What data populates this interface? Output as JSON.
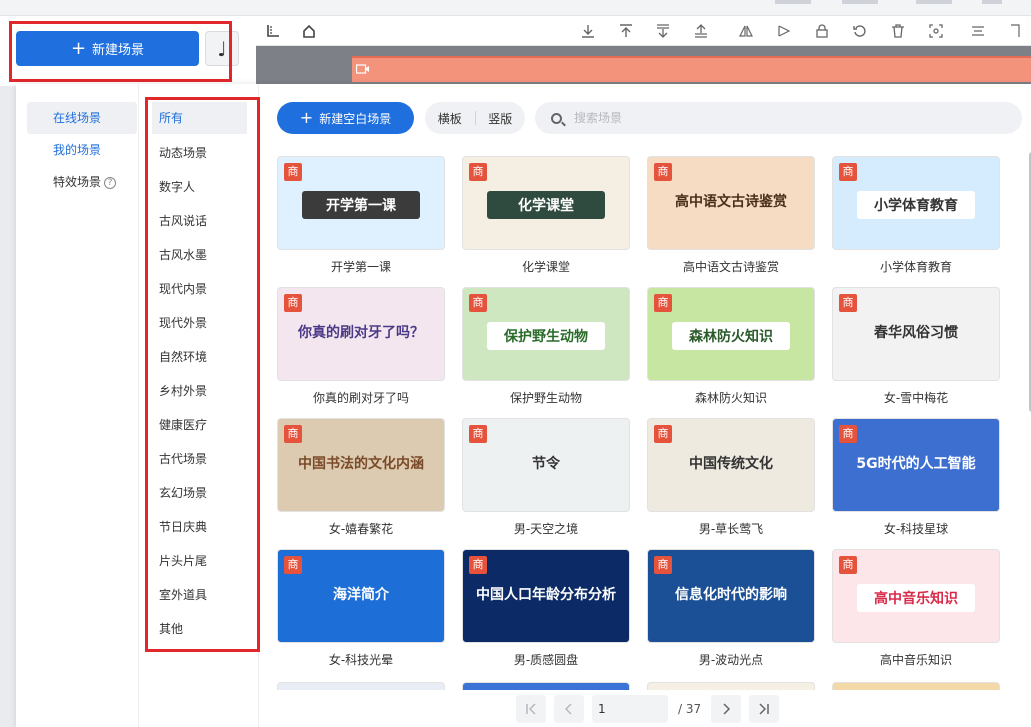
{
  "left_top": {
    "new_scene_label": "新建场景",
    "music_icon": "♩"
  },
  "timeline": {
    "track_label": ""
  },
  "tabs": [
    {
      "label": "在线场景",
      "active": true
    },
    {
      "label": "我的场景",
      "active": false
    },
    {
      "label": "特效场景",
      "active": false,
      "help": "?"
    }
  ],
  "categories": [
    "所有",
    "动态场景",
    "数字人",
    "古风说话",
    "古风水墨",
    "现代内景",
    "现代外景",
    "自然环境",
    "乡村外景",
    "健康医疗",
    "古代场景",
    "玄幻场景",
    "节日庆典",
    "片头片尾",
    "室外道具",
    "其他"
  ],
  "actions": {
    "blank_scene_label": "新建空白场景",
    "landscape_label": "横板",
    "portrait_label": "竖版"
  },
  "search": {
    "placeholder": "搜索场景"
  },
  "badge_label": "商",
  "cards": [
    {
      "name": "开学第一课",
      "thumb_title": "开学第一课",
      "bg": "#dff0ff",
      "fg": "#ffffff",
      "title_bg": "#3b3b3b"
    },
    {
      "name": "化学课堂",
      "thumb_title": "化学课堂",
      "bg": "#f4efe2",
      "fg": "#ffffff",
      "title_bg": "#2f4a3f"
    },
    {
      "name": "高中语文古诗鉴赏",
      "thumb_title": "高中语文古诗鉴赏",
      "bg": "#f7dcc4",
      "fg": "#4a2e1a",
      "title_bg": "transparent"
    },
    {
      "name": "小学体育教育",
      "thumb_title": "小学体育教育",
      "bg": "#d5ecff",
      "fg": "#333333",
      "title_bg": "#ffffff"
    },
    {
      "name": "你真的刷对牙了吗",
      "thumb_title": "你真的刷对牙了吗？",
      "bg": "#f3e6ef",
      "fg": "#4a3a88",
      "title_bg": "transparent"
    },
    {
      "name": "保护野生动物",
      "thumb_title": "保护野生动物",
      "bg": "#cfe7c1",
      "fg": "#2a6b2a",
      "title_bg": "#ffffff"
    },
    {
      "name": "森林防火知识",
      "thumb_title": "森林防火知识",
      "bg": "#c6e6a2",
      "fg": "#2a5a2a",
      "title_bg": "#ffffff"
    },
    {
      "name": "女-雪中梅花",
      "thumb_title": "春华风俗习惯",
      "bg": "#f2f2f2",
      "fg": "#333333",
      "title_bg": "transparent"
    },
    {
      "name": "女-嬉春繁花",
      "thumb_title": "中国书法的文化内涵",
      "bg": "#dccbb0",
      "fg": "#7a4a2a",
      "title_bg": "transparent"
    },
    {
      "name": "男-天空之境",
      "thumb_title": "节令",
      "bg": "#eef1f2",
      "fg": "#333333",
      "title_bg": "transparent"
    },
    {
      "name": "男-草长莺飞",
      "thumb_title": "中国传统文化",
      "bg": "#eeeae0",
      "fg": "#333333",
      "title_bg": "transparent"
    },
    {
      "name": "女-科技星球",
      "thumb_title": "5G时代的人工智能",
      "bg": "#3d6fd1",
      "fg": "#ffffff",
      "title_bg": "transparent"
    },
    {
      "name": "女-科技光晕",
      "thumb_title": "海洋简介",
      "bg": "#1e6ed8",
      "fg": "#ffffff",
      "title_bg": "transparent"
    },
    {
      "name": "男-质感圆盘",
      "thumb_title": "中国人口年龄分布分析",
      "bg": "#0b2a66",
      "fg": "#ffffff",
      "title_bg": "transparent"
    },
    {
      "name": "男-波动光点",
      "thumb_title": "信息化时代的影响",
      "bg": "#1b4f96",
      "fg": "#ffffff",
      "title_bg": "transparent"
    },
    {
      "name": "高中音乐知识",
      "thumb_title": "高中音乐知识",
      "bg": "#fde6ea",
      "fg": "#d82b4a",
      "title_bg": "#ffffff"
    }
  ],
  "pager": {
    "current": "1",
    "total": "/ 37"
  }
}
